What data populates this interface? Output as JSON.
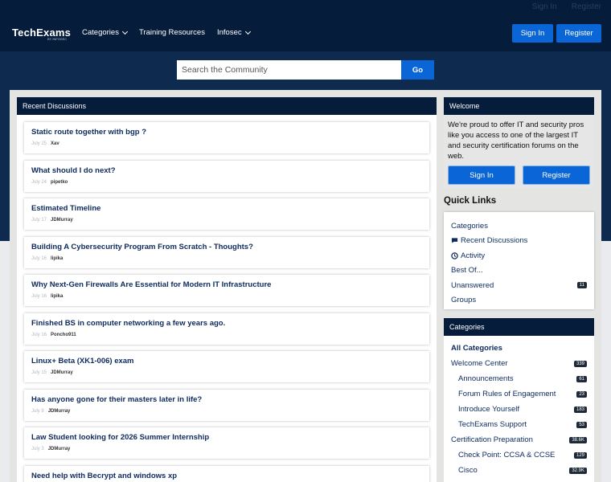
{
  "header": {
    "top_links": [
      "Sign In",
      "Register"
    ],
    "logo": "TechExams",
    "logo_sub": "BY INFOSEC",
    "nav": [
      {
        "label": "Categories",
        "dropdown": true
      },
      {
        "label": "Training Resources",
        "dropdown": false
      },
      {
        "label": "Infosec",
        "dropdown": true
      }
    ],
    "signin_label": "Sign In",
    "register_label": "Register"
  },
  "search": {
    "placeholder": "Search the Community",
    "go_label": "Go"
  },
  "discussions": {
    "title": "Recent Discussions",
    "items": [
      {
        "title": "Static route together with bgp ?",
        "date": "July 25",
        "author": "Xav"
      },
      {
        "title": "What should I do next?",
        "date": "July 24",
        "author": "pipetko"
      },
      {
        "title": "Estimated Timeline",
        "date": "July 17",
        "author": "JDMurray"
      },
      {
        "title": "Building A Cybersecurity Program From Scratch - Thoughts?",
        "date": "July 16",
        "author": "lipika"
      },
      {
        "title": "Why Next-Gen Firewalls Are Essential for Modern IT Infrastructure",
        "date": "July 16",
        "author": "lipika"
      },
      {
        "title": "Finished BS in computer networking a few years ago.",
        "date": "July 16",
        "author": "Poncho911"
      },
      {
        "title": "Linux+ Beta (XK1-006) exam",
        "date": "July 15",
        "author": "JDMurray"
      },
      {
        "title": "Has anyone gone for their masters later in life?",
        "date": "July 8",
        "author": "JDMurray"
      },
      {
        "title": "Law Student looking for 2026 Summer Internship",
        "date": "July 3",
        "author": "JDMurray"
      },
      {
        "title": "Need help with Becrypt and windows xp",
        "date": "",
        "author": ""
      }
    ]
  },
  "welcome": {
    "title": "Welcome",
    "text": "We're proud to offer IT and security pros like you access to one of the largest IT and security certification forums on the web.",
    "signin_label": "Sign In",
    "register_label": "Register"
  },
  "quick_links": {
    "title": "Quick Links",
    "items": [
      {
        "label": "Categories",
        "icon": "",
        "count": ""
      },
      {
        "label": "Recent Discussions",
        "icon": "chat-icon",
        "count": ""
      },
      {
        "label": "Activity",
        "icon": "activity-icon",
        "count": ""
      },
      {
        "label": "Best Of...",
        "icon": "",
        "count": ""
      },
      {
        "label": "Unanswered",
        "icon": "",
        "count": "11"
      },
      {
        "label": "Groups",
        "icon": "",
        "count": ""
      }
    ]
  },
  "categories": {
    "title": "Categories",
    "items": [
      {
        "label": "All Categories",
        "count": "",
        "sub": false,
        "bold": true
      },
      {
        "label": "Welcome Center",
        "count": "339",
        "sub": false,
        "bold": false
      },
      {
        "label": "Announcements",
        "count": "61",
        "sub": true,
        "bold": false
      },
      {
        "label": "Forum Rules of Engagement",
        "count": "23",
        "sub": true,
        "bold": false
      },
      {
        "label": "Introduce Yourself",
        "count": "183",
        "sub": true,
        "bold": false
      },
      {
        "label": "TechExams Support",
        "count": "53",
        "sub": true,
        "bold": false
      },
      {
        "label": "Certification Preparation",
        "count": "38.6K",
        "sub": false,
        "bold": false
      },
      {
        "label": "Check Point: CCSA & CCSE",
        "count": "129",
        "sub": true,
        "bold": false
      },
      {
        "label": "Cisco",
        "count": "32.9K",
        "sub": true,
        "bold": false
      },
      {
        "label": "",
        "count": "",
        "sub": true,
        "bold": false
      }
    ]
  },
  "colors": {
    "navy": "#061c3b",
    "hero": "#0e2a4e",
    "accent": "#0a66d6",
    "link": "#0c2a5e"
  }
}
